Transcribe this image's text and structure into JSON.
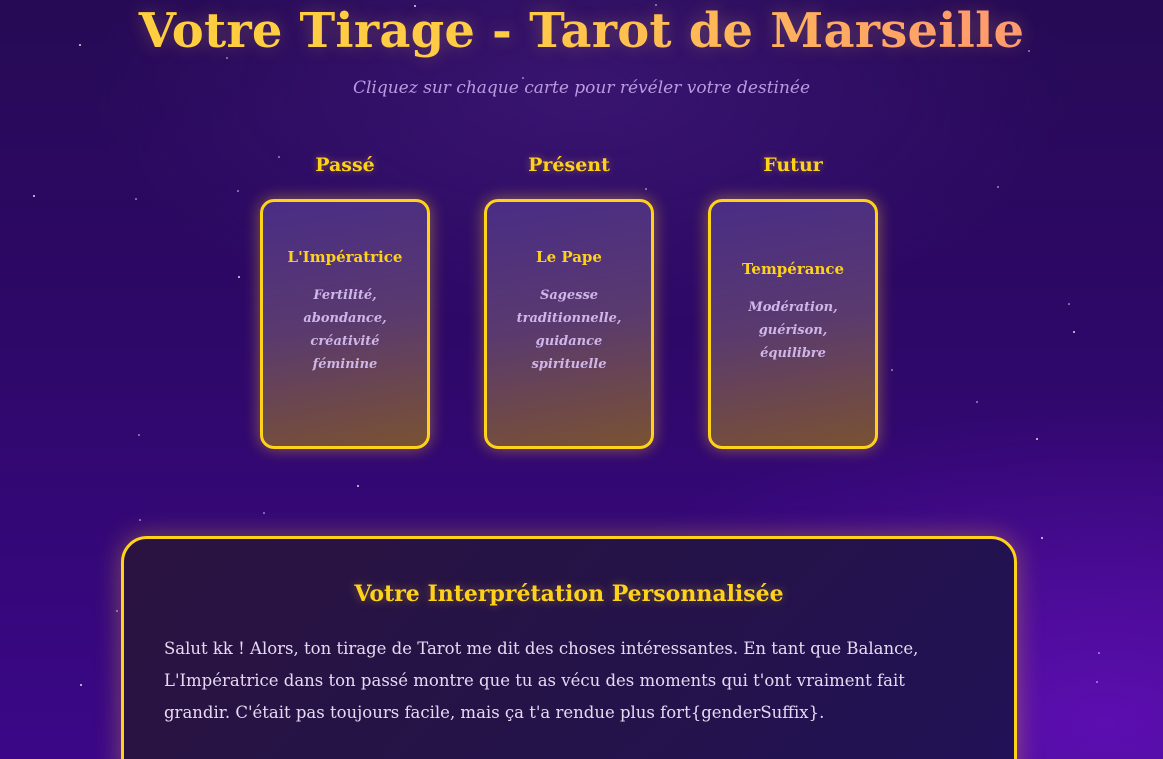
{
  "page": {
    "title": "Votre Tirage - Tarot de Marseille",
    "subtitle": "Cliquez sur chaque carte pour révéler votre destinée"
  },
  "spread": [
    {
      "position": "Passé",
      "card": "L'Impératrice",
      "meaning": "Fertilité, abondance, créativité féminine"
    },
    {
      "position": "Présent",
      "card": "Le Pape",
      "meaning": "Sagesse traditionnelle, guidance spirituelle"
    },
    {
      "position": "Futur",
      "card": "Tempérance",
      "meaning": "Modération, guérison, équilibre"
    }
  ],
  "interpretation": {
    "title": "Votre Interprétation Personnalisée",
    "text": "Salut kk ! Alors, ton tirage de Tarot me dit des choses intéressantes. En tant que Balance, L'Impératrice dans ton passé montre que tu as vécu des moments qui t'ont vraiment fait grandir. C'était pas toujours facile, mais ça t'a rendue plus fort{genderSuffix}."
  },
  "colors": {
    "accent": "#ffd21a",
    "background": "#2d0866",
    "meaning_text": "#cfb6e8"
  }
}
